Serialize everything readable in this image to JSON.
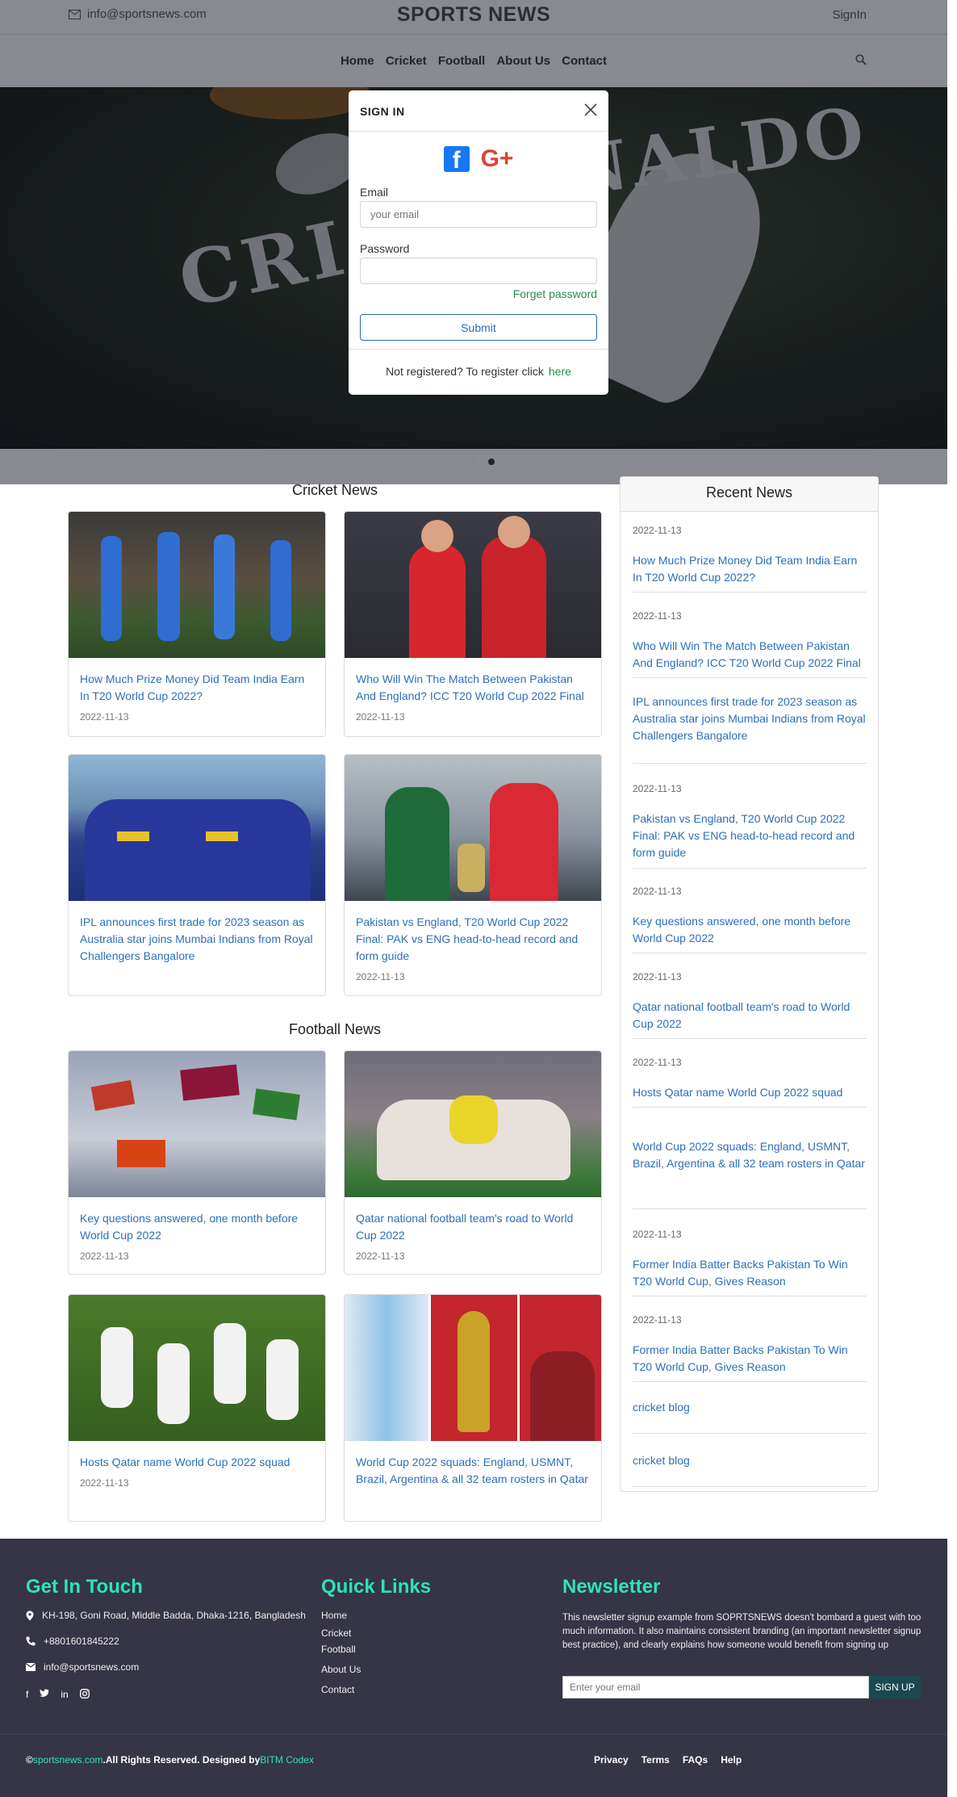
{
  "header": {
    "email": "info@sportsnews.com",
    "brand": "SPORTS NEWS",
    "signin": "SignIn",
    "nav": [
      "Home",
      "Cricket",
      "Football",
      "About Us",
      "Contact"
    ]
  },
  "hero": {
    "word_left": "CRIST",
    "word_right": "NALDO",
    "slides": 3,
    "active_slide": 3
  },
  "modal": {
    "title": "SIGN IN",
    "email_label": "Email",
    "email_placeholder": "your email",
    "password_label": "Password",
    "forget": "Forget password",
    "submit": "Submit",
    "footer_text": "Not registered? To register click",
    "footer_link": "here"
  },
  "cricket": {
    "title": "Cricket News",
    "cards": [
      {
        "title": "How Much Prize Money Did Team India Earn In T20 World Cup 2022?",
        "date": "2022-11-13"
      },
      {
        "title": "Who Will Win The Match Between Pakistan And England? ICC T20 World Cup 2022 Final",
        "date": "2022-11-13"
      },
      {
        "title": "IPL announces first trade for 2023 season as Australia star joins Mumbai Indians from Royal Challengers Bangalore",
        "date": ""
      },
      {
        "title": "Pakistan vs England, T20 World Cup 2022 Final: PAK vs ENG head-to-head record and form guide",
        "date": "2022-11-13"
      }
    ]
  },
  "football": {
    "title": "Football News",
    "cards": [
      {
        "title": "Key questions answered, one month before World Cup 2022",
        "date": "2022-11-13"
      },
      {
        "title": "Qatar national football team's road to World Cup 2022",
        "date": "2022-11-13"
      },
      {
        "title": "Hosts Qatar name World Cup 2022 squad",
        "date": "2022-11-13"
      },
      {
        "title": "World Cup 2022 squads: England, USMNT, Brazil, Argentina & all 32 team rosters in Qatar",
        "date": ""
      }
    ]
  },
  "recent": {
    "title": "Recent News",
    "items": [
      {
        "date": "2022-11-13",
        "title": "How Much Prize Money Did Team India Earn In T20 World Cup 2022?"
      },
      {
        "date": "2022-11-13",
        "title": "Who Will Win The Match Between Pakistan And England? ICC T20 World Cup 2022 Final"
      },
      {
        "date": "",
        "title": "IPL announces first trade for 2023 season as Australia star joins Mumbai Indians from Royal Challengers Bangalore"
      },
      {
        "date": "2022-11-13",
        "title": "Pakistan vs England, T20 World Cup 2022 Final: PAK vs ENG head-to-head record and form guide"
      },
      {
        "date": "2022-11-13",
        "title": "Key questions answered, one month before World Cup 2022"
      },
      {
        "date": "2022-11-13",
        "title": "Qatar national football team's road to World Cup 2022"
      },
      {
        "date": "2022-11-13",
        "title": "Hosts Qatar name World Cup 2022 squad"
      },
      {
        "date": "",
        "title": "World Cup 2022 squads: England, USMNT, Brazil, Argentina & all 32 team rosters in Qatar"
      },
      {
        "date": "2022-11-13",
        "title": "Former India Batter Backs Pakistan To Win T20 World Cup, Gives Reason"
      },
      {
        "date": "2022-11-13",
        "title": "Former India Batter Backs Pakistan To Win T20 World Cup, Gives Reason"
      },
      {
        "date": "",
        "title": "cricket blog"
      },
      {
        "date": "",
        "title": "cricket blog"
      }
    ]
  },
  "footer": {
    "contact_title": "Get In Touch",
    "address": "KH-198, Goni Road, Middle Badda, Dhaka-1216, Bangladesh",
    "phone": "+8801601845222",
    "email": "info@sportsnews.com",
    "links_title": "Quick Links",
    "links": [
      "Home",
      "Cricket",
      "Football",
      "About Us",
      "Contact"
    ],
    "newsletter_title": "Newsletter",
    "newsletter_text": "This newsletter signup example from SOPRTSNEWS doesn't bombard a guest with too much information. It also maintains consistent branding (an important newsletter signup best practice), and clearly explains how someone would benefit from signing up",
    "newsletter_placeholder": "Enter your email",
    "newsletter_button": "SIGN UP",
    "copyright_prefix": "©",
    "copyright_site": "sportsnews.com",
    "copyright_text": ".All Rights Reserved. Designed by",
    "copyright_designer": "BITM Codex",
    "bottom_links": [
      "Privacy",
      "Terms",
      "FAQs",
      "Help"
    ]
  },
  "colors": {
    "accent": "#2de3b8",
    "link": "#2c6fbb",
    "footer_bg": "#363545"
  }
}
